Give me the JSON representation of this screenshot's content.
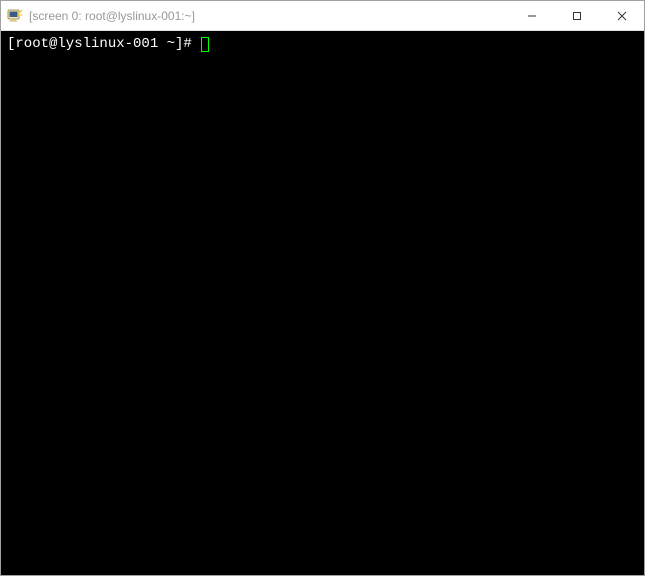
{
  "window": {
    "title": "[screen 0: root@lyslinux-001:~]"
  },
  "terminal": {
    "prompt": "[root@lyslinux-001 ~]# "
  }
}
